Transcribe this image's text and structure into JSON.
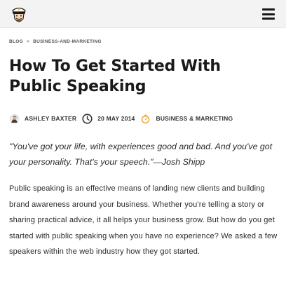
{
  "header": {
    "logo_icon": "captain-mascot-logo",
    "menu_icon": "hamburger-menu-icon"
  },
  "breadcrumb": {
    "items": [
      "BLOG",
      "BUSINESS-AND-MARKETING"
    ],
    "separator": ">"
  },
  "article": {
    "title": "How To Get Started With Public Speaking",
    "author": "ASHLEY BAXTER",
    "date": "20 MAY 2014",
    "category": "BUSINESS & MARKETING",
    "quote": "\"You've got your life, with experiences good and bad. And you've got your personality. That's your speech.\"—Josh Shipp",
    "intro": "Public speaking is an effective means of landing new clients and building brand awareness around your business. Whether you're telling a story or sharing practical advice, it all helps your business grow. But how do you get started with public speaking when you have no experience? We asked a few speakers within the web industry how they got started."
  },
  "colors": {
    "topbar_bg": "#f3f3f3",
    "text": "#222222",
    "category_icon": "#f0a030"
  }
}
